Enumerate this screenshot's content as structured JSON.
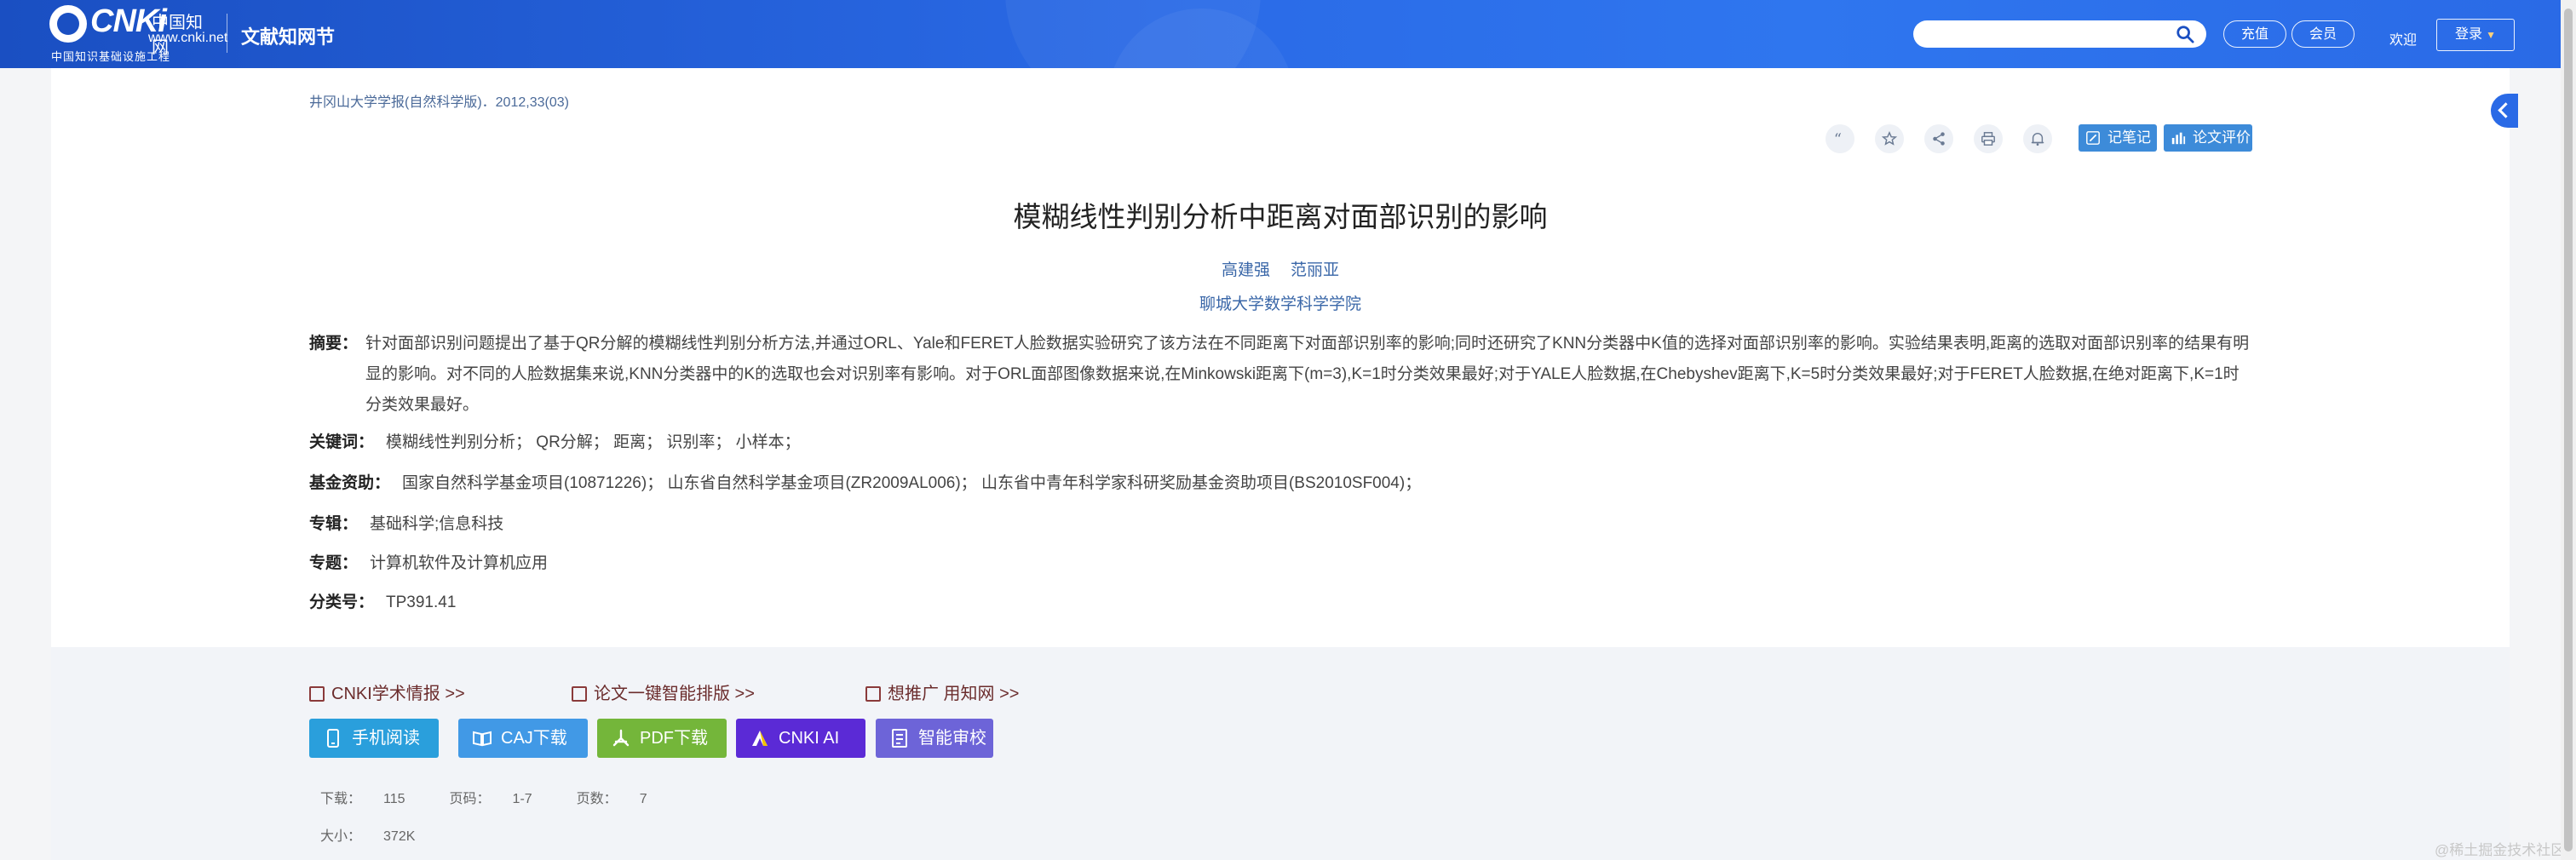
{
  "header": {
    "logo_cnki": "CNKi",
    "logo_cn": "中国知网",
    "logo_url": "www.cnki.net",
    "logo_subtitle": "中国知识基础设施工程",
    "site_name": "文献知网节",
    "search_placeholder": "",
    "recharge_label": "充值",
    "member_label": "会员",
    "welcome": "欢迎",
    "login_label": "登录"
  },
  "article": {
    "source": "井冈山大学学报(自然科学版)．2012,33(03)",
    "title": "模糊线性判别分析中距离对面部识别的影响",
    "authors": [
      "高建强",
      "范丽亚"
    ],
    "affiliation": "聊城大学数学科学学院",
    "abstract_label": "摘要：",
    "abstract": "针对面部识别问题提出了基于QR分解的模糊线性判别分析方法,并通过ORL、Yale和FERET人脸数据实验研究了该方法在不同距离下对面部识别率的影响;同时还研究了KNN分类器中K值的选择对面部识别率的影响。实验结果表明,距离的选取对面部识别率的结果有明显的影响。对不同的人脸数据集来说,KNN分类器中的K的选取也会对识别率有影响。对于ORL面部图像数据来说,在Minkowski距离下(m=3),K=1时分类效果最好;对于YALE人脸数据,在Chebyshev距离下,K=5时分类效果最好;对于FERET人脸数据,在绝对距离下,K=1时分类效果最好。",
    "keywords_label": "关键词：",
    "keywords": "模糊线性判别分析；  QR分解；  距离；  识别率；  小样本；",
    "funding_label": "基金资助：",
    "funding": "国家自然科学基金项目(10871226)；   山东省自然科学基金项目(ZR2009AL006)；   山东省中青年科学家科研奖励基金资助项目(BS2010SF004)；",
    "series_label": "专辑：",
    "series": "基础科学;信息科技",
    "topic_label": "专题：",
    "topic": "计算机软件及计算机应用",
    "class_label": "分类号：",
    "class_no": "TP391.41"
  },
  "toolbar": {
    "note_label": "记笔记",
    "eval_label": "论文评价",
    "icons": [
      "quote-icon",
      "star-icon",
      "share-icon",
      "print-icon",
      "bell-icon"
    ]
  },
  "links": {
    "intel": "CNKI学术情报 >>",
    "typeset": "论文一键智能排版 >>",
    "promote": "想推广 用知网 >>"
  },
  "downloads": {
    "phone": "手机阅读",
    "caj": "CAJ下载",
    "pdf": "PDF下载",
    "ai": "CNKI AI",
    "check": "智能审校"
  },
  "stats": {
    "downloads_label": "下载：",
    "downloads": "115",
    "pages_label": "页码：",
    "pages": "1-7",
    "page_count_label": "页数：",
    "page_count": "7",
    "size_label": "大小：",
    "size": "372K"
  },
  "watermark": "@稀土掘金技术社区",
  "colors": {
    "header_blue": "#2a6ae6",
    "link_blue": "#3a67a8",
    "btn_phone": "#2a9fdc",
    "btn_caj": "#4199e6",
    "btn_pdf": "#74b63a",
    "btn_ai": "#5b2ad6",
    "btn_check": "#6d64d8"
  }
}
